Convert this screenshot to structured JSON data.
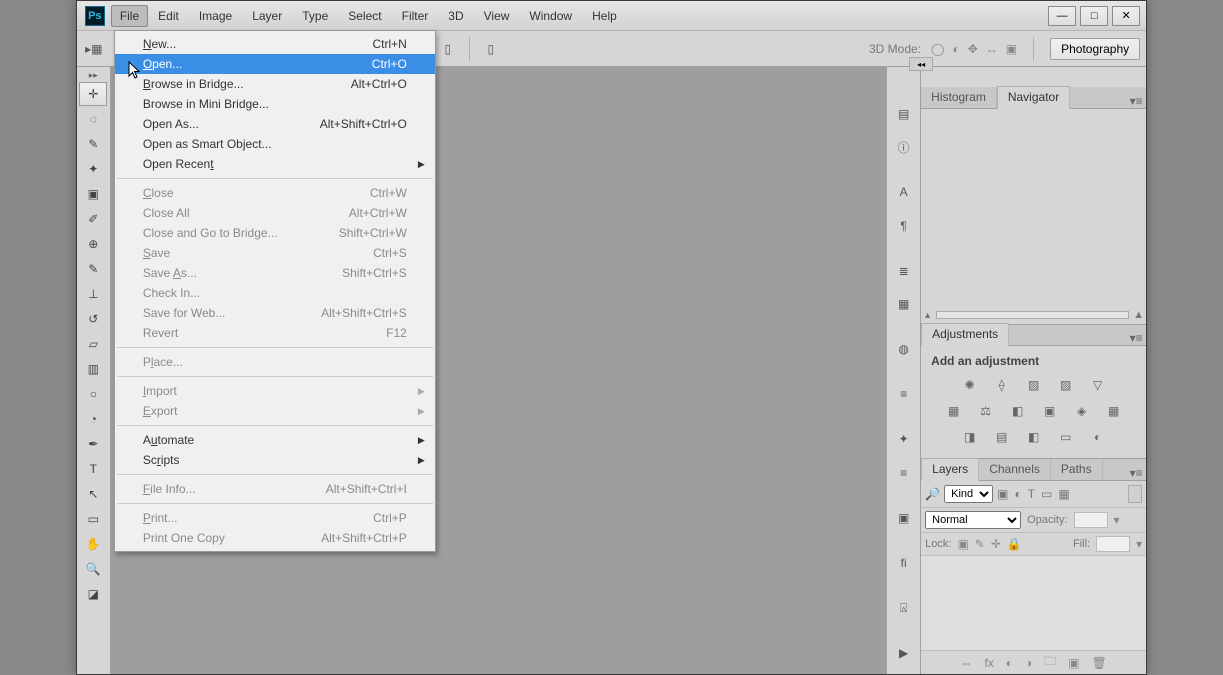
{
  "app": {
    "logo_text": "Ps"
  },
  "window_controls": {
    "min": "—",
    "max": "□",
    "close": "✕"
  },
  "menubar": [
    "File",
    "Edit",
    "Image",
    "Layer",
    "Type",
    "Select",
    "Filter",
    "3D",
    "View",
    "Window",
    "Help"
  ],
  "file_menu": {
    "items": [
      {
        "label": "New...",
        "shortcut": "Ctrl+N",
        "underline": "N"
      },
      {
        "label": "Open...",
        "shortcut": "Ctrl+O",
        "hover": true,
        "underline": "O"
      },
      {
        "label": "Browse in Bridge...",
        "shortcut": "Alt+Ctrl+O",
        "underline": "B"
      },
      {
        "label": "Browse in Mini Bridge..."
      },
      {
        "label": "Open As...",
        "shortcut": "Alt+Shift+Ctrl+O"
      },
      {
        "label": "Open as Smart Object..."
      },
      {
        "label": "Open Recent",
        "submenu": true,
        "underline": "t"
      },
      {
        "sep": true
      },
      {
        "label": "Close",
        "shortcut": "Ctrl+W",
        "disabled": true,
        "underline": "C"
      },
      {
        "label": "Close All",
        "shortcut": "Alt+Ctrl+W",
        "disabled": true
      },
      {
        "label": "Close and Go to Bridge...",
        "shortcut": "Shift+Ctrl+W",
        "disabled": true
      },
      {
        "label": "Save",
        "shortcut": "Ctrl+S",
        "disabled": true,
        "underline": "S"
      },
      {
        "label": "Save As...",
        "shortcut": "Shift+Ctrl+S",
        "disabled": true,
        "underline": "A"
      },
      {
        "label": "Check In...",
        "disabled": true
      },
      {
        "label": "Save for Web...",
        "shortcut": "Alt+Shift+Ctrl+S",
        "disabled": true
      },
      {
        "label": "Revert",
        "shortcut": "F12",
        "disabled": true
      },
      {
        "sep": true
      },
      {
        "label": "Place...",
        "disabled": true,
        "underline": "l"
      },
      {
        "sep": true
      },
      {
        "label": "Import",
        "submenu": true,
        "disabled": true,
        "underline": "I"
      },
      {
        "label": "Export",
        "submenu": true,
        "disabled": true,
        "underline": "E"
      },
      {
        "sep": true
      },
      {
        "label": "Automate",
        "submenu": true,
        "underline": "u"
      },
      {
        "label": "Scripts",
        "submenu": true,
        "underline": "r"
      },
      {
        "sep": true
      },
      {
        "label": "File Info...",
        "shortcut": "Alt+Shift+Ctrl+I",
        "disabled": true,
        "underline": "F"
      },
      {
        "sep": true
      },
      {
        "label": "Print...",
        "shortcut": "Ctrl+P",
        "disabled": true,
        "underline": "P"
      },
      {
        "label": "Print One Copy",
        "shortcut": "Alt+Shift+Ctrl+P",
        "disabled": true
      }
    ]
  },
  "options_bar": {
    "mode_label": "3D Mode:",
    "workspace_btn": "Photography"
  },
  "panels": {
    "nav": {
      "tabs": [
        "Histogram",
        "Navigator"
      ],
      "active": 1
    },
    "adjustments": {
      "tabs": [
        "Adjustments"
      ],
      "title": "Add an adjustment"
    },
    "layers": {
      "tabs": [
        "Layers",
        "Channels",
        "Paths"
      ],
      "active": 0,
      "filter_kind": "Kind",
      "blend": "Normal",
      "opacity_label": "Opacity:",
      "lock_label": "Lock:",
      "fill_label": "Fill:"
    }
  },
  "tool_strip": [
    "move",
    "marquee",
    "lasso",
    "wand",
    "crop",
    "eyedrop",
    "heal",
    "brush",
    "stamp",
    "history",
    "eraser",
    "gradient",
    "blur",
    "dodge",
    "pen",
    "type",
    "path-sel",
    "shape",
    "hand",
    "zoom",
    "swatches"
  ],
  "rail": [
    "doc-info",
    "info",
    "character",
    "paragraph",
    "brush-settings",
    "layer-comps",
    "gradient",
    "brush",
    "actions",
    "styles",
    "fi",
    "clone",
    "play"
  ]
}
